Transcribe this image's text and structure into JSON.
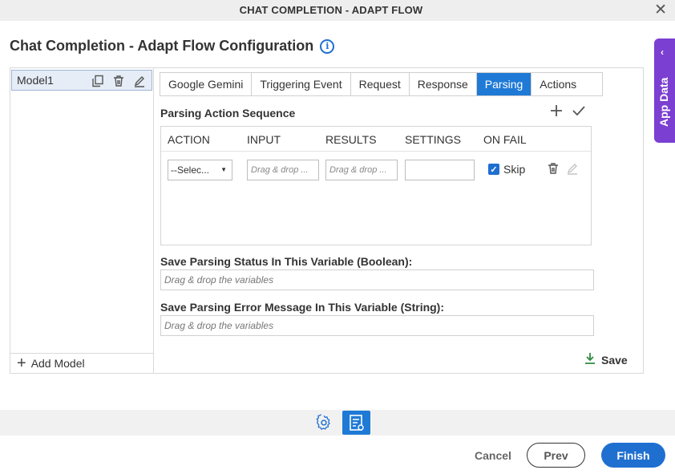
{
  "window": {
    "title": "CHAT COMPLETION - ADAPT FLOW",
    "close_glyph": "✕"
  },
  "page": {
    "heading": "Chat Completion - Adapt Flow Configuration",
    "info_glyph": "i"
  },
  "app_data": {
    "label": "App Data",
    "chevron": "‹",
    "color": "#7b3fd1"
  },
  "models": {
    "items": [
      {
        "label": "Model1"
      }
    ],
    "add_label": "Add Model"
  },
  "tabs": [
    {
      "label": "Google Gemini",
      "active": false
    },
    {
      "label": "Triggering Event",
      "active": false
    },
    {
      "label": "Request",
      "active": false
    },
    {
      "label": "Response",
      "active": false
    },
    {
      "label": "Parsing",
      "active": true
    },
    {
      "label": "Actions",
      "active": false
    }
  ],
  "parsing": {
    "section_title": "Parsing Action Sequence",
    "columns": {
      "action": "ACTION",
      "input": "INPUT",
      "results": "RESULTS",
      "settings": "SETTINGS",
      "on_fail": "ON FAIL"
    },
    "row": {
      "action_value": "--Selec...",
      "input_placeholder": "Drag & drop ...",
      "results_placeholder": "Drag & drop ...",
      "settings_value": "",
      "skip_checked": true,
      "skip_label": "Skip"
    },
    "status_label": "Save Parsing Status In This Variable (Boolean):",
    "status_placeholder": "Drag & drop the variables",
    "error_label": "Save Parsing Error Message In This Variable (String):",
    "error_placeholder": "Drag & drop the variables",
    "save_label": "Save"
  },
  "footer": {
    "cancel": "Cancel",
    "prev": "Prev",
    "finish": "Finish"
  },
  "colors": {
    "accent": "#1f7ad6",
    "primary_button": "#1f6fd1",
    "save_icon": "#2e8b3d"
  }
}
